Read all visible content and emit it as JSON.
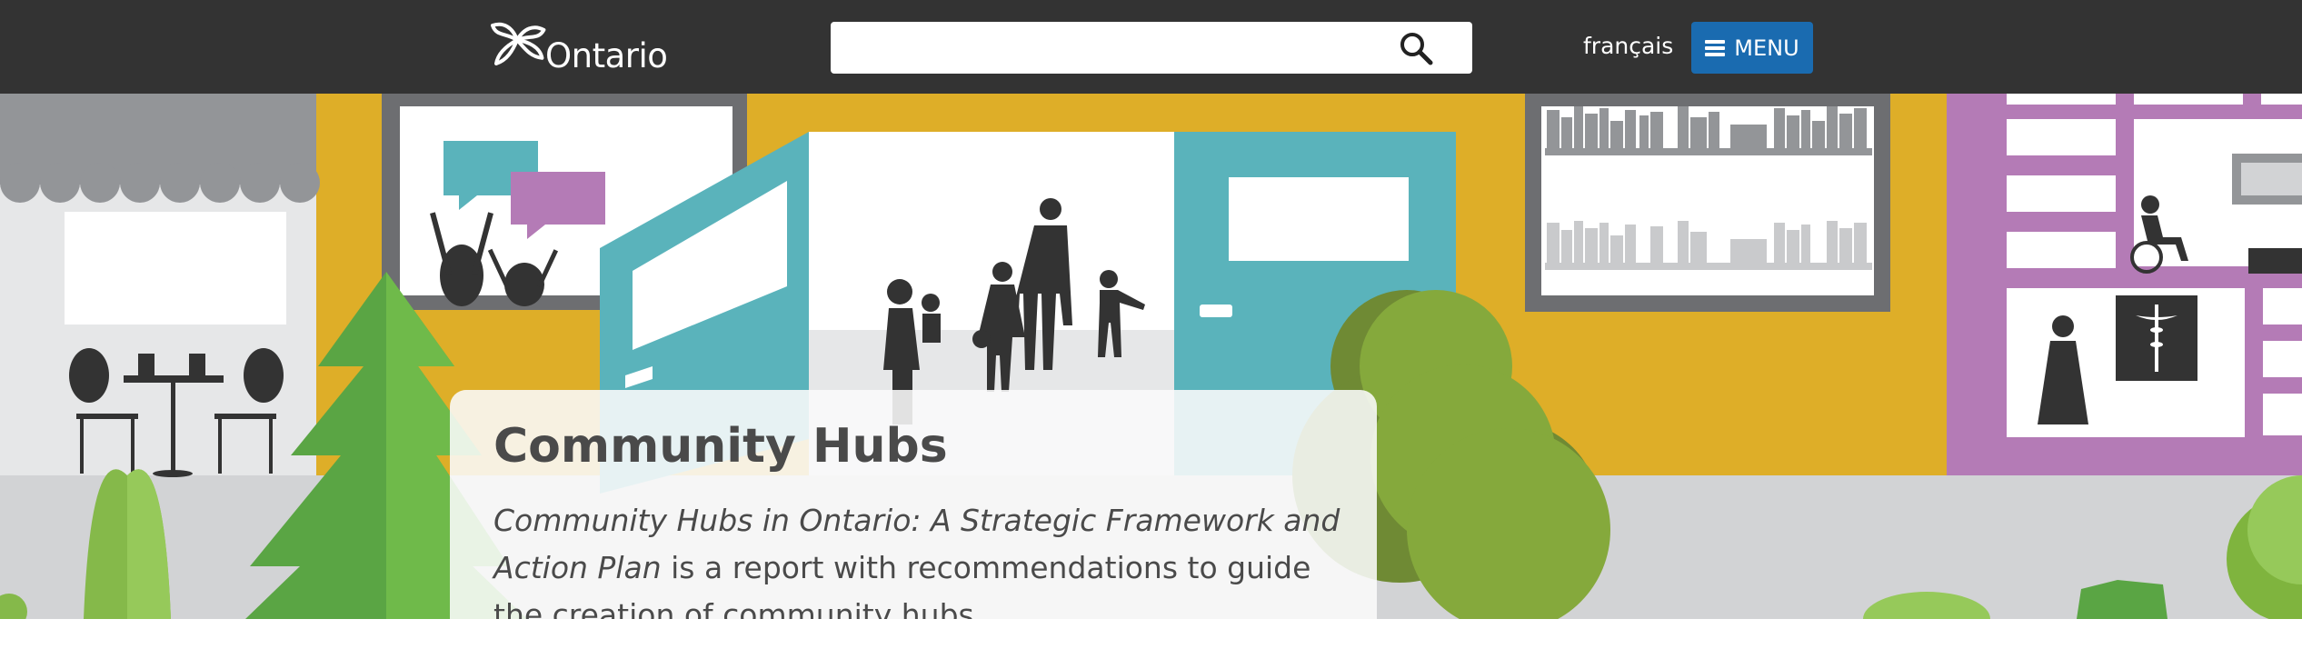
{
  "header": {
    "logo_text": "Ontario",
    "search": {
      "placeholder": "",
      "value": ""
    },
    "language_link": "français",
    "menu_label": "MENU"
  },
  "hero": {
    "title": "Community Hubs",
    "description_italic": "Community Hubs in Ontario: A Strategic Framework and Action Plan",
    "description_rest": " is a report with recommendations to guide the creation of community hubs."
  },
  "colors": {
    "topbar": "#333333",
    "menu_button": "#1a6bb0",
    "mustard_wall": "#deae28",
    "teal": "#5ab3bb",
    "purple": "#b47bb6",
    "tree_green": "#5aa544",
    "bush_green": "#85a93c"
  },
  "icons": [
    "trillium-logo-icon",
    "search-icon",
    "hamburger-icon"
  ]
}
